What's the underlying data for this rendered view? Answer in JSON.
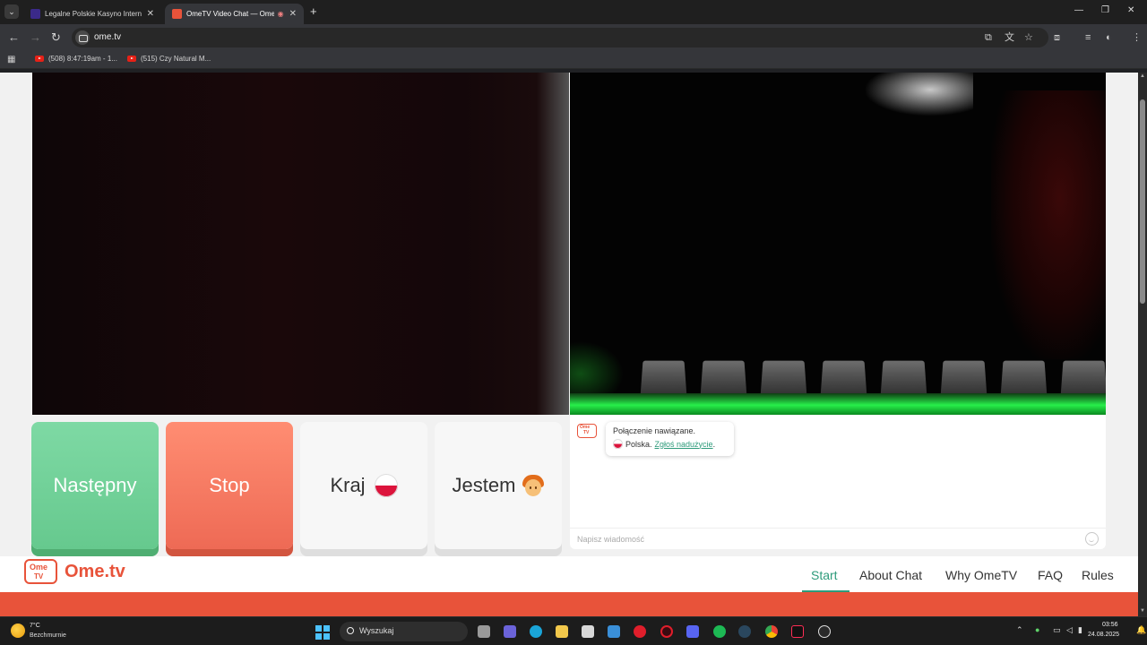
{
  "browser": {
    "tabs": [
      {
        "title": "Legalne Polskie Kasyno Internet",
        "active": false
      },
      {
        "title": "OmeTV Video Chat — Ome",
        "active": true
      }
    ],
    "url": "ome.tv",
    "bookmarks": [
      {
        "label": "(508) 8:47:19am - 1..."
      },
      {
        "label": "(515) Czy Natural M..."
      }
    ]
  },
  "controls": {
    "next_label": "Następny",
    "stop_label": "Stop",
    "country_label": "Kraj",
    "gender_label": "Jestem"
  },
  "chat": {
    "connected_text": "Połączenie nawiązane.",
    "country_text": "Polska.",
    "report_link": "Zgłoś nadużycie",
    "report_suffix": ".",
    "input_placeholder": "Napisz wiadomość"
  },
  "site_nav": {
    "brand": "Ome.tv",
    "logo_top": "Ome",
    "logo_bottom": "TV",
    "items": [
      "Start",
      "About Chat",
      "Why OmeTV",
      "FAQ",
      "Rules"
    ],
    "active": "Start"
  },
  "taskbar": {
    "temperature": "7°C",
    "weather": "Bezchmurnie",
    "search": "Wyszukaj",
    "time": "03:56",
    "date": "24.08.2025"
  },
  "colors": {
    "brand_orange": "#e8533a",
    "next_green": "#6fcf97",
    "stop_red": "#f47a62",
    "accent_teal": "#2e9b7b"
  }
}
